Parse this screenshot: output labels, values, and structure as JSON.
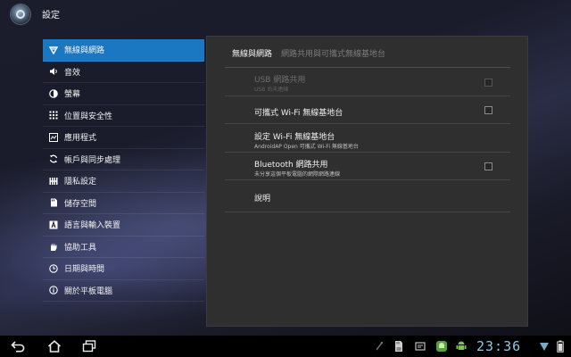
{
  "app": {
    "title": "設定"
  },
  "menu": {
    "items": [
      {
        "label": "無線與網路",
        "icon": "wifi-icon",
        "selected": true
      },
      {
        "label": "音效",
        "icon": "speaker-icon",
        "selected": false
      },
      {
        "label": "螢幕",
        "icon": "brightness-icon",
        "selected": false
      },
      {
        "label": "位置與安全性",
        "icon": "location-security-icon",
        "selected": false
      },
      {
        "label": "應用程式",
        "icon": "applications-icon",
        "selected": false
      },
      {
        "label": "帳戶與同步處理",
        "icon": "sync-icon",
        "selected": false
      },
      {
        "label": "隱私設定",
        "icon": "privacy-icon",
        "selected": false
      },
      {
        "label": "儲存空間",
        "icon": "storage-icon",
        "selected": false
      },
      {
        "label": "語言與輸入裝置",
        "icon": "language-icon",
        "selected": false
      },
      {
        "label": "協助工具",
        "icon": "accessibility-icon",
        "selected": false
      },
      {
        "label": "日期與時間",
        "icon": "clock-icon",
        "selected": false
      },
      {
        "label": "關於平板電腦",
        "icon": "info-icon",
        "selected": false
      }
    ]
  },
  "panel": {
    "title": "無線與網路",
    "subtitle": "網路共用與可攜式無線基地台",
    "rows": [
      {
        "title": "USB 網路共用",
        "summary": "USB 尚未連線",
        "has_checkbox": true,
        "enabled": false,
        "checked": false
      },
      {
        "title": "可攜式 Wi-Fi 無線基地台",
        "summary": "",
        "has_checkbox": true,
        "enabled": true,
        "checked": false
      },
      {
        "title": "設定 Wi-Fi 無線基地台",
        "summary": "AndroidAP Open 可攜式 Wi-Fi 無線基地台",
        "has_checkbox": false,
        "enabled": true
      },
      {
        "title": "Bluetooth 網路共用",
        "summary": "未分享這個平板電腦的網際網路連線",
        "has_checkbox": true,
        "enabled": true,
        "checked": false
      },
      {
        "title": "說明",
        "summary": "",
        "has_checkbox": false,
        "enabled": true
      }
    ]
  },
  "status_bar": {
    "clock": "23:36"
  },
  "colors": {
    "accent": "#1a78c2",
    "clock": "#8ec9e8"
  }
}
